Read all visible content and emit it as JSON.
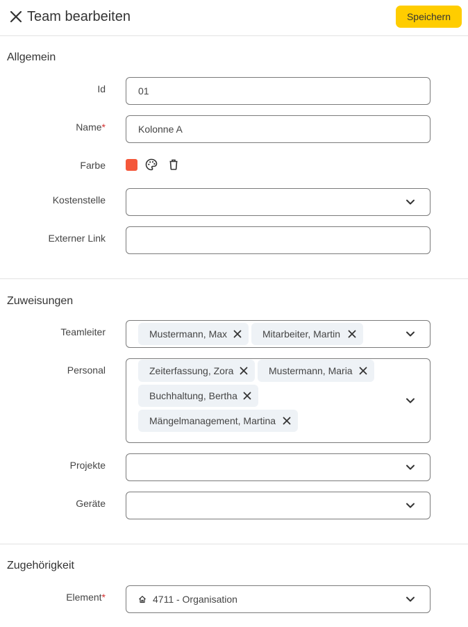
{
  "header": {
    "title": "Team bearbeiten",
    "save_label": "Speichern"
  },
  "colors": {
    "accent": "#ffcd00",
    "team_color": "#f4573a",
    "required_marker": "#d32f2f"
  },
  "sections": {
    "general": {
      "title": "Allgemein",
      "id": {
        "label": "Id",
        "value": "01"
      },
      "name": {
        "label": "Name",
        "required": "*",
        "value": "Kolonne A"
      },
      "color": {
        "label": "Farbe"
      },
      "cost_center": {
        "label": "Kostenstelle",
        "value": ""
      },
      "external_link": {
        "label": "Externer Link",
        "value": ""
      }
    },
    "assignments": {
      "title": "Zuweisungen",
      "team_leader": {
        "label": "Teamleiter",
        "chips": [
          "Mustermann, Max",
          "Mitarbeiter, Martin"
        ]
      },
      "personnel": {
        "label": "Personal",
        "chips": [
          "Zeiterfassung, Zora",
          "Mustermann, Maria",
          "Buchhaltung, Bertha",
          "Mängelmanagement, Martina"
        ]
      },
      "projects": {
        "label": "Projekte",
        "value": ""
      },
      "devices": {
        "label": "Geräte",
        "value": ""
      }
    },
    "membership": {
      "title": "Zugehörigkeit",
      "element": {
        "label": "Element",
        "required": "*",
        "value": "4711 - Organisation",
        "icon": "home-icon"
      }
    }
  }
}
